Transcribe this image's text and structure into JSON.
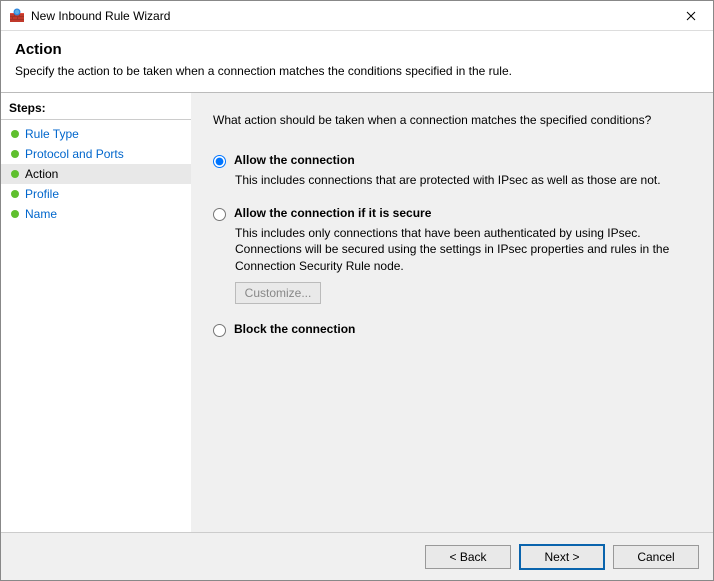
{
  "window": {
    "title": "New Inbound Rule Wizard"
  },
  "header": {
    "title": "Action",
    "subtitle": "Specify the action to be taken when a connection matches the conditions specified in the rule."
  },
  "sidebar": {
    "heading": "Steps:",
    "items": [
      {
        "label": "Rule Type",
        "current": false
      },
      {
        "label": "Protocol and Ports",
        "current": false
      },
      {
        "label": "Action",
        "current": true
      },
      {
        "label": "Profile",
        "current": false
      },
      {
        "label": "Name",
        "current": false
      }
    ]
  },
  "content": {
    "prompt": "What action should be taken when a connection matches the specified conditions?",
    "options": [
      {
        "id": "allow",
        "label": "Allow the connection",
        "desc": "This includes connections that are protected with IPsec as well as those are not.",
        "selected": true
      },
      {
        "id": "allow-secure",
        "label": "Allow the connection if it is secure",
        "desc": "This includes only connections that have been authenticated by using IPsec.  Connections will be secured using the settings in IPsec properties and rules in the Connection Security Rule node.",
        "selected": false,
        "customize_label": "Customize..."
      },
      {
        "id": "block",
        "label": "Block the connection",
        "desc": "",
        "selected": false
      }
    ]
  },
  "footer": {
    "back": "< Back",
    "next": "Next >",
    "cancel": "Cancel"
  }
}
